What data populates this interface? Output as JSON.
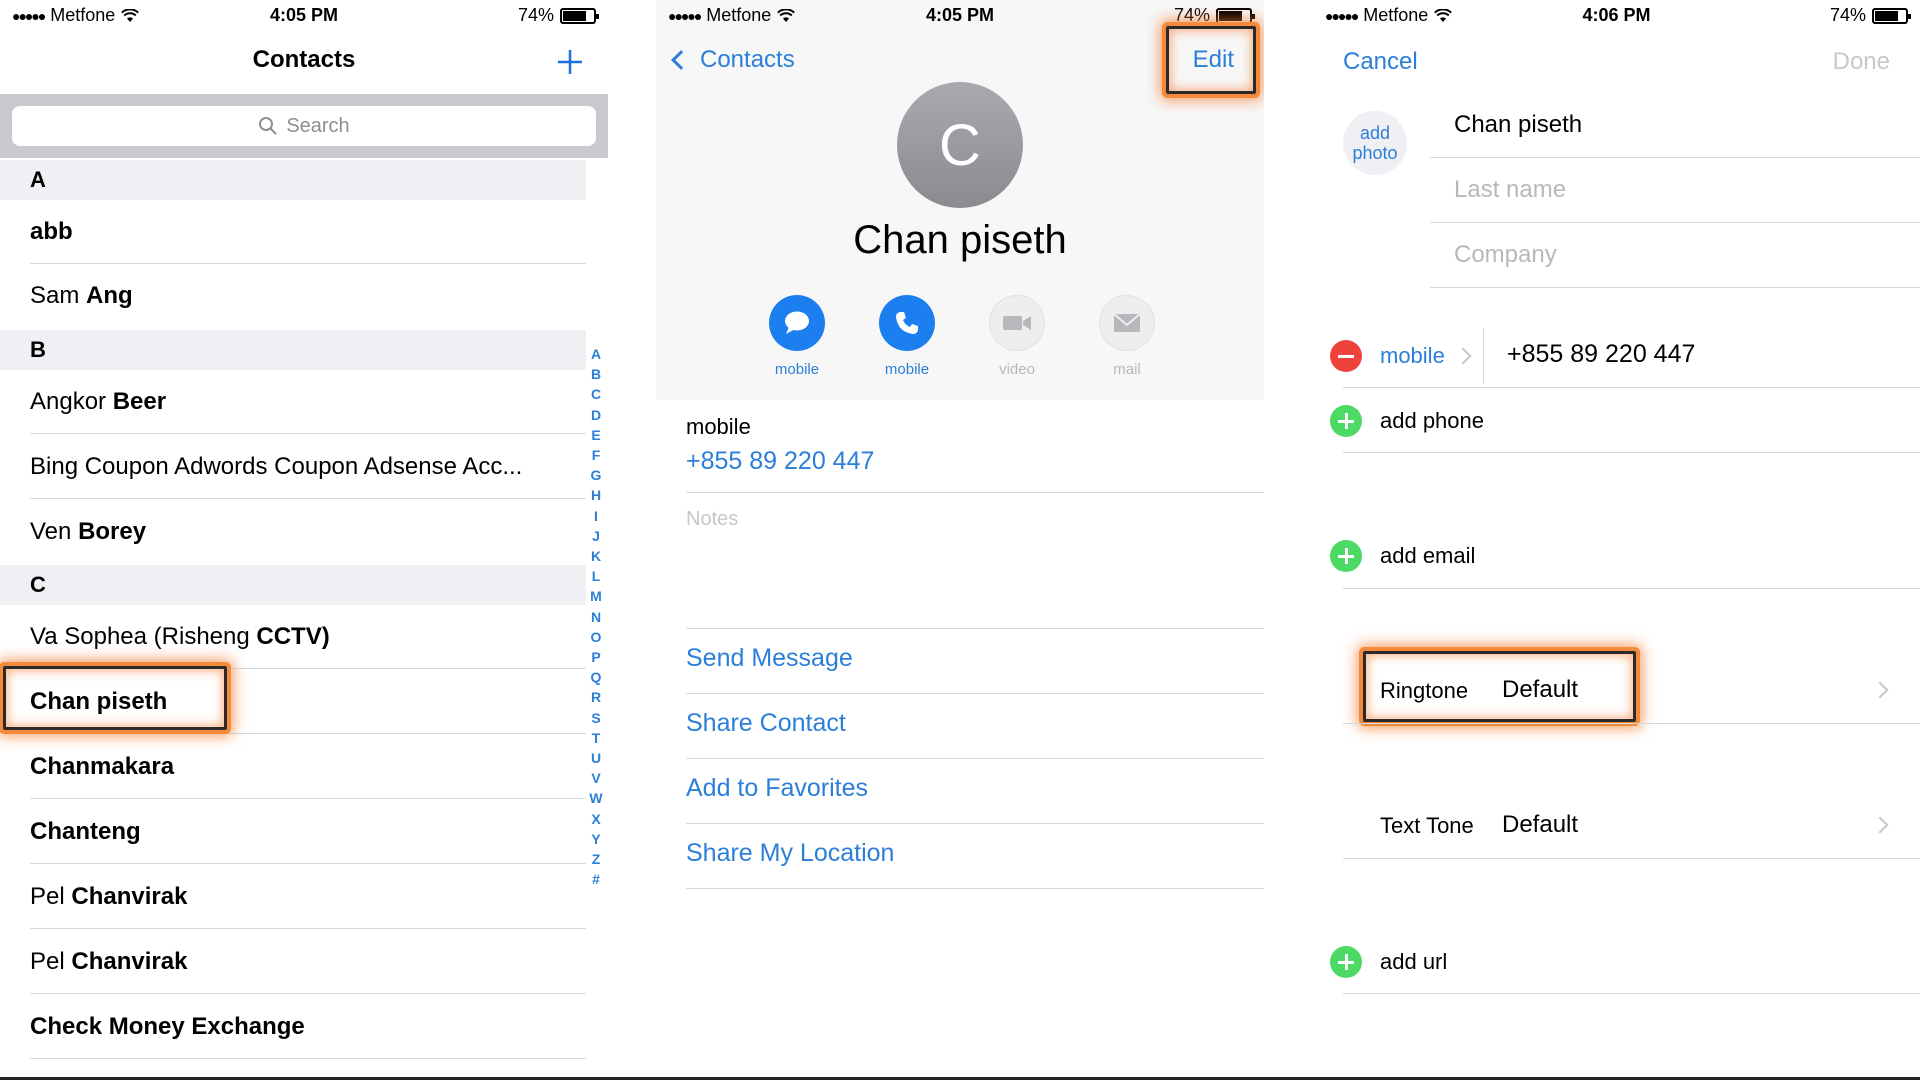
{
  "status": {
    "carrier": "Metfone",
    "battery": "74%",
    "p1_time": "4:05 PM",
    "p2_time": "4:05 PM",
    "p3_time": "4:06 PM"
  },
  "contacts_list": {
    "title": "Contacts",
    "search_placeholder": "Search",
    "sections": {
      "a": "A",
      "b": "B",
      "c": "C"
    },
    "rows": {
      "abb": "abb",
      "sam_first": "Sam",
      "sam_last": "Ang",
      "angkor_first": "Angkor",
      "angkor_last": "Beer",
      "bing": "Bing Coupon Adwords Coupon Adsense Acc...",
      "ven_first": "Ven",
      "ven_last": "Borey",
      "va_first": "Va Sophea (Risheng",
      "va_last": "CCTV)",
      "chan": "Chan piseth",
      "chanmakara": "Chanmakara",
      "chanteng": "Chanteng",
      "pel1_first": "Pel",
      "pel1_last": "Chanvirak",
      "pel2_first": "Pel",
      "pel2_last": "Chanvirak",
      "check": "Check Money Exchange"
    },
    "index_letters": [
      "A",
      "B",
      "C",
      "D",
      "E",
      "F",
      "G",
      "H",
      "I",
      "J",
      "K",
      "L",
      "M",
      "N",
      "O",
      "P",
      "Q",
      "R",
      "S",
      "T",
      "U",
      "V",
      "W",
      "X",
      "Y",
      "Z",
      "#"
    ]
  },
  "contact_detail": {
    "back": "Contacts",
    "edit": "Edit",
    "initial": "C",
    "name": "Chan piseth",
    "actions": {
      "message": "mobile",
      "call": "mobile",
      "video": "video",
      "mail": "mail"
    },
    "phone_label": "mobile",
    "phone": "+855 89 220 447",
    "notes": "Notes",
    "send_message": "Send Message",
    "share_contact": "Share Contact",
    "add_favorites": "Add to Favorites",
    "share_location": "Share My Location"
  },
  "edit_contact": {
    "cancel": "Cancel",
    "done": "Done",
    "add_photo_1": "add",
    "add_photo_2": "photo",
    "first_name": "Chan piseth",
    "last_name_placeholder": "Last name",
    "company_placeholder": "Company",
    "phone_label": "mobile",
    "phone": "+855 89 220 447",
    "add_phone": "add phone",
    "add_email": "add email",
    "ringtone_label": "Ringtone",
    "ringtone_value": "Default",
    "texttone_label": "Text Tone",
    "texttone_value": "Default",
    "add_url": "add url"
  },
  "colors": {
    "accent": "#2b7fd9",
    "highlight": "#f58a3a"
  }
}
